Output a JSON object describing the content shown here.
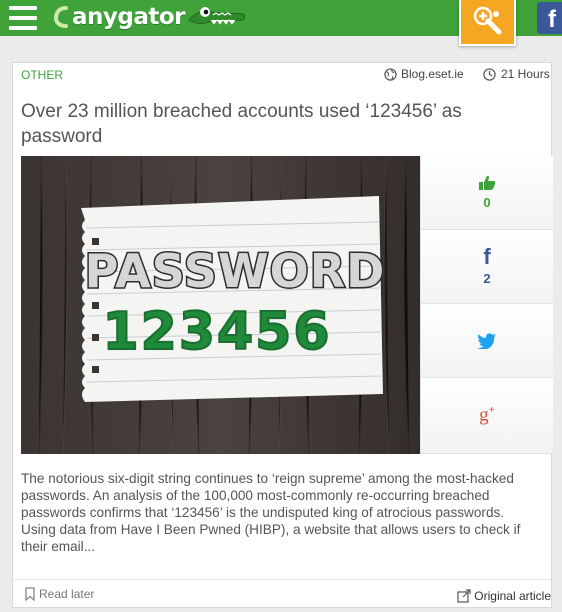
{
  "header": {
    "logo_text": "anygator"
  },
  "article": {
    "category": "OTHER",
    "source": "Blog.eset.ie",
    "age": "21 Hours",
    "title": "Over 23 million breached accounts used ‘123456’ as password",
    "image": {
      "word": "PASSWORD",
      "number": "123456"
    },
    "likes": "0",
    "facebook_shares": "2",
    "excerpt": "The notorious six-digit string continues to ‘reign supreme’ among the most-hacked passwords. An analysis of the 100,000 most-commonly re-occurring breached passwords confirms that ‘123456’ is the undisputed king of atrocious passwords. Using data from Have I Been Pwned (HIBP), a website that allows users to check if their email...",
    "read_later": "Read later",
    "original_article": "Original article"
  },
  "colors": {
    "brand_green": "#3fa33a",
    "promo_orange": "#f5a623",
    "facebook_blue": "#3b5998",
    "twitter_blue": "#1da1f2",
    "gplus_red": "#dd4b39"
  },
  "icons": [
    "menu-icon",
    "gator-icon",
    "promo-icon",
    "facebook-icon",
    "globe-icon",
    "clock-icon",
    "thumbs-up-icon",
    "twitter-icon",
    "google-plus-icon",
    "bookmark-icon",
    "external-link-icon"
  ]
}
